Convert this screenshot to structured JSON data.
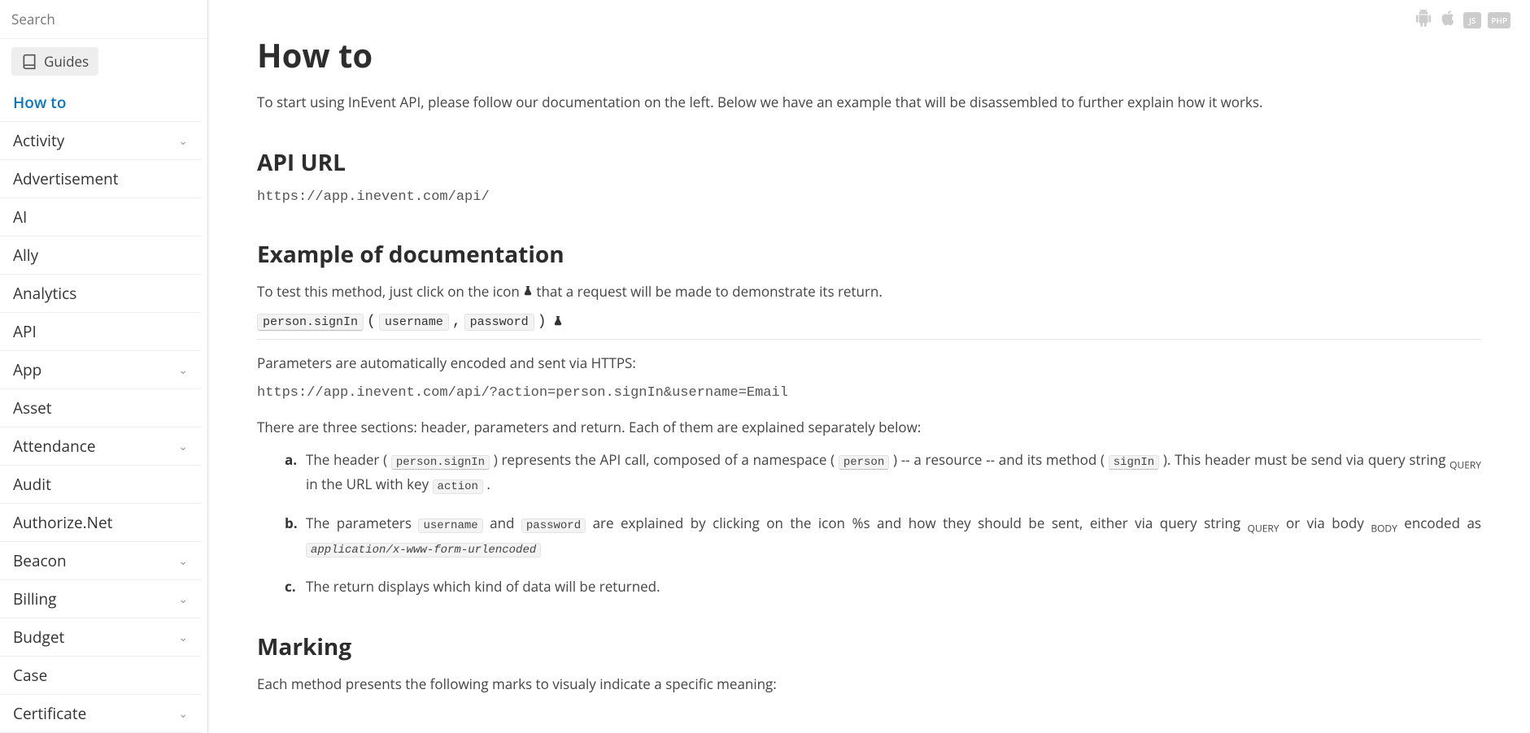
{
  "search": {
    "placeholder": "Search"
  },
  "guides": {
    "label": "Guides"
  },
  "sidebar": {
    "items": [
      {
        "label": "How to",
        "active": true,
        "expandable": false
      },
      {
        "label": "Activity",
        "active": false,
        "expandable": true
      },
      {
        "label": "Advertisement",
        "active": false,
        "expandable": false
      },
      {
        "label": "AI",
        "active": false,
        "expandable": false
      },
      {
        "label": "Ally",
        "active": false,
        "expandable": false
      },
      {
        "label": "Analytics",
        "active": false,
        "expandable": false
      },
      {
        "label": "API",
        "active": false,
        "expandable": false
      },
      {
        "label": "App",
        "active": false,
        "expandable": true
      },
      {
        "label": "Asset",
        "active": false,
        "expandable": false
      },
      {
        "label": "Attendance",
        "active": false,
        "expandable": true
      },
      {
        "label": "Audit",
        "active": false,
        "expandable": false
      },
      {
        "label": "Authorize.Net",
        "active": false,
        "expandable": false
      },
      {
        "label": "Beacon",
        "active": false,
        "expandable": true
      },
      {
        "label": "Billing",
        "active": false,
        "expandable": true
      },
      {
        "label": "Budget",
        "active": false,
        "expandable": true
      },
      {
        "label": "Case",
        "active": false,
        "expandable": false
      },
      {
        "label": "Certificate",
        "active": false,
        "expandable": true
      }
    ]
  },
  "top_badges": {
    "js": "JS",
    "php": "PHP"
  },
  "content": {
    "title": "How to",
    "intro": "To start using InEvent API, please follow our documentation on the left. Below we have an example that will be disassembled to further explain how it works.",
    "api_url_heading": "API URL",
    "api_url": "https://app.inevent.com/api/",
    "example_heading": "Example of documentation",
    "test_text_before": "To test this method, just click on the icon ",
    "test_text_after": " that a request will be made to demonstrate its return.",
    "method": {
      "name": "person.signIn",
      "params": [
        "username",
        "password"
      ]
    },
    "params_auto": "Parameters are automatically encoded and sent via HTTPS:",
    "encoded_url": "https://app.inevent.com/api/?action=person.signIn&username=Email",
    "sections_intro": "There are three sections: header, parameters and return. Each of them are explained separately below:",
    "list": {
      "a": {
        "t1": "The header (",
        "c1": "person.signIn",
        "t2": ") represents the API call, composed of a namespace (",
        "c2": "person",
        "t3": ") -- a resource -- and its method (",
        "c3": "signIn",
        "t4": "). This header must be send via query string ",
        "q": "QUERY",
        "t5": " in the URL with key ",
        "c4": "action",
        "t6": "."
      },
      "b": {
        "t1": "The parameters ",
        "c1": "username",
        "t2": " and ",
        "c2": "password",
        "t3": " are explained by clicking on the icon %s and how they should be sent, either via query string ",
        "q": "QUERY",
        "t4": " or via body ",
        "body": "BODY",
        "t5": " encoded as ",
        "ct": "application/x-www-form-urlencoded"
      },
      "c": "The return displays which kind of data will be returned."
    },
    "marking_heading": "Marking",
    "marking_text": "Each method presents the following marks to visualy indicate a specific meaning:"
  }
}
